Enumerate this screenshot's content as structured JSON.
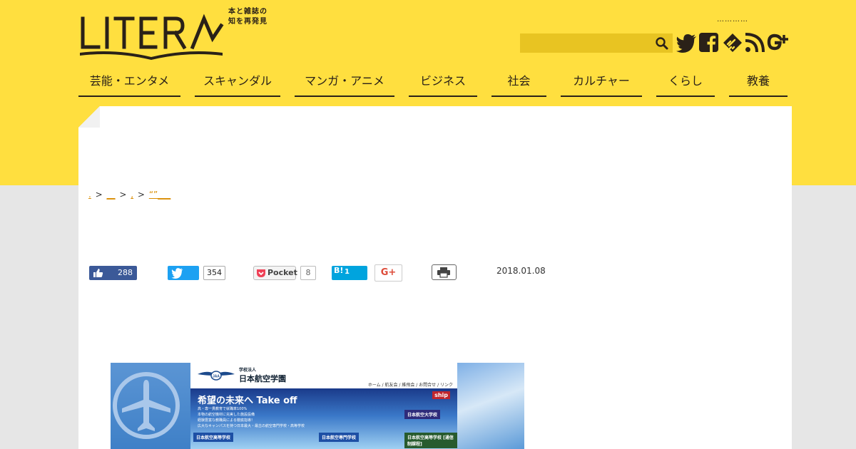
{
  "brand": {
    "logo_text": "LITERA",
    "tagline_line1": "本と雑誌の",
    "tagline_line2": "知を再発見",
    "colors": {
      "yellow": "#ffdf3f",
      "dark": "#2a2118",
      "link": "#d98c00"
    }
  },
  "header": {
    "dots": "…………",
    "search": {
      "placeholder": "",
      "icon": "search-icon"
    },
    "social": [
      "twitter-icon",
      "facebook-icon",
      "feedly-icon",
      "rss-icon",
      "google-plus-icon"
    ]
  },
  "nav": {
    "items": [
      {
        "label": "芸能・エンタメ"
      },
      {
        "label": "スキャンダル"
      },
      {
        "label": "マンガ・アニメ"
      },
      {
        "label": "ビジネス"
      },
      {
        "label": "社会"
      },
      {
        "label": "カルチャー"
      },
      {
        "label": "くらし"
      },
      {
        "label": "教養"
      }
    ]
  },
  "breadcrumb": {
    "home": ".",
    "sep": ">",
    "cat": "__",
    "sub": ",",
    "current": "“”___"
  },
  "share": {
    "facebook_count": "288",
    "twitter_count": "354",
    "pocket_label": "Pocket",
    "pocket_count": "8",
    "hatena_label": "B!",
    "hatena_count": "1",
    "gplus_label": "G+"
  },
  "article": {
    "date": "2018.01.08"
  },
  "hero": {
    "school_small": "学校法人",
    "school_name": "日本航空学園",
    "links": "ホーム / 航友会 / 維飛会 / お問合せ / リンク",
    "slogan": "希望の未来へ Take off",
    "ship": "ship",
    "bullets": [
      "高・専一貫教育で就職率100%",
      "本物の航空機材に充実した施設設備",
      "経験豊富な教職員による徹底指導！",
      "広大なキャンパスを持つ日本最大・最古の航空専門学校・高等学校"
    ],
    "card1": "日本航空大学校",
    "card2": "日本航空高等学校",
    "card3": "日本航空専門学校",
    "card4": "日本航空高等学校 [通信制課程]"
  }
}
